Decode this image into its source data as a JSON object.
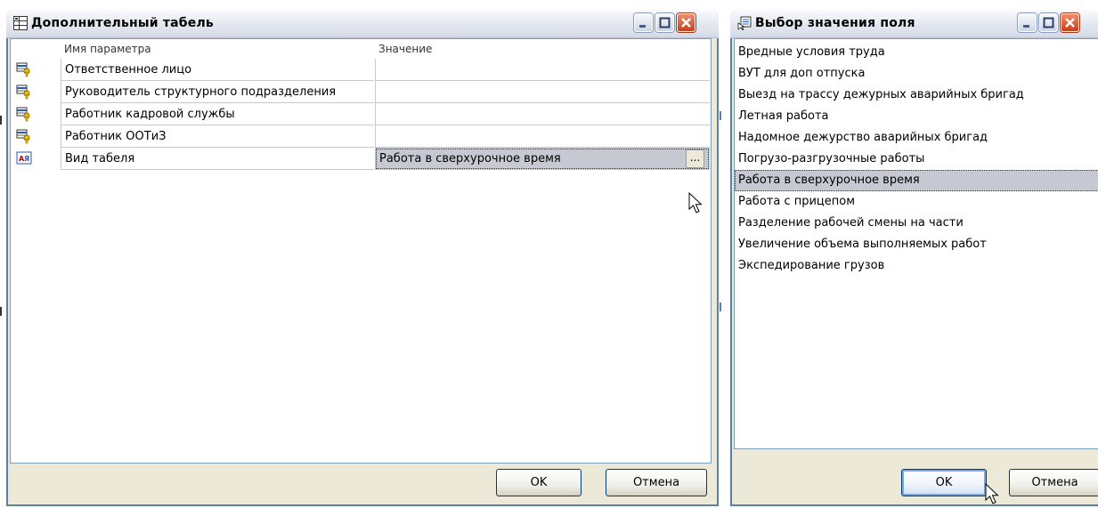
{
  "window_main": {
    "title": "Дополнительный табель",
    "icon": "table-properties-icon",
    "columns": [
      "Имя параметра",
      "Значение"
    ],
    "rows": [
      {
        "icon": "person-key-icon",
        "name": "Ответственное лицо",
        "value": ""
      },
      {
        "icon": "person-key-icon",
        "name": "Руководитель структурного подразделения",
        "value": ""
      },
      {
        "icon": "person-key-icon",
        "name": "Работник кадровой службы",
        "value": ""
      },
      {
        "icon": "person-key-icon",
        "name": "Работник ООТиЗ",
        "value": ""
      },
      {
        "icon": "text-field-icon",
        "name": "Вид табеля",
        "value": "Работа в сверхурочное время"
      }
    ],
    "ellipsis_label": "...",
    "ok_label": "OK",
    "cancel_label": "Отмена"
  },
  "window_select": {
    "title": "Выбор значения поля",
    "icon": "list-select-icon",
    "items": [
      "Вредные условия труда",
      "ВУТ для доп отпуска",
      "Выезд на трассу дежурных аварийных бригад",
      "Летная работа",
      "Надомное дежурство аварийных бригад",
      "Погрузо-разгрузочные работы",
      "Работа в сверхурочное время",
      "Работа с прицепом",
      "Разделение рабочей смены на части",
      "Увеличение объема выполняемых работ",
      "Экспедирование грузов"
    ],
    "selected_item": "Работа в сверхурочное время",
    "ok_label": "OK",
    "cancel_label": "Отмена"
  },
  "colors": {
    "selection": "#c7c9d2",
    "window_frame": "#5c7fa8",
    "close_button": "#c7401c",
    "panel_bg": "#ece9d8"
  }
}
